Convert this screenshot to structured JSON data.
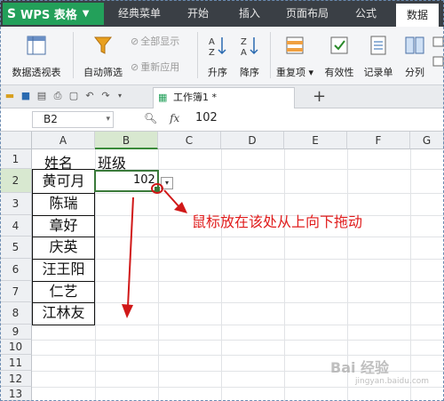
{
  "app": {
    "title": "WPS 表格"
  },
  "menu": {
    "tabs": [
      "经典菜单",
      "开始",
      "插入",
      "页面布局",
      "公式",
      "数据"
    ],
    "active": "数据"
  },
  "ribbon": {
    "pivot": "数据透视表",
    "autofilter": "自动筛选",
    "show_all": "全部显示",
    "reapply": "重新应用",
    "asc": "升序",
    "desc": "降序",
    "duplicates": "重复项",
    "validity": "有效性",
    "record": "记录单",
    "split": "分列"
  },
  "doc": {
    "tab_label": "工作簿1 *",
    "add": "+"
  },
  "formula": {
    "cell_ref": "B2",
    "fx": "fx",
    "value": "102"
  },
  "columns": [
    "A",
    "B",
    "C",
    "D",
    "E",
    "F",
    "G"
  ],
  "rows": [
    "1",
    "2",
    "3",
    "4",
    "5",
    "6",
    "7",
    "8",
    "9",
    "10",
    "11",
    "12",
    "13"
  ],
  "cells": {
    "A1": "姓名",
    "B1": "班级",
    "A2": "黄可月",
    "B2": "102",
    "A3": "陈瑞",
    "A4": "章好",
    "A5": "庆英",
    "A6": "汪王阳",
    "A7": "仁艺",
    "A8": "江林友"
  },
  "annotation": {
    "text": "鼠标放在该处从上向下拖动",
    "color": "#e01c1c"
  },
  "watermark": {
    "text": "Bai 经验",
    "sub": "jingyan.baidu.com"
  },
  "colors": {
    "brand": "#23a05a",
    "menubar": "#3a3f45",
    "selection": "#3a7a3a"
  }
}
